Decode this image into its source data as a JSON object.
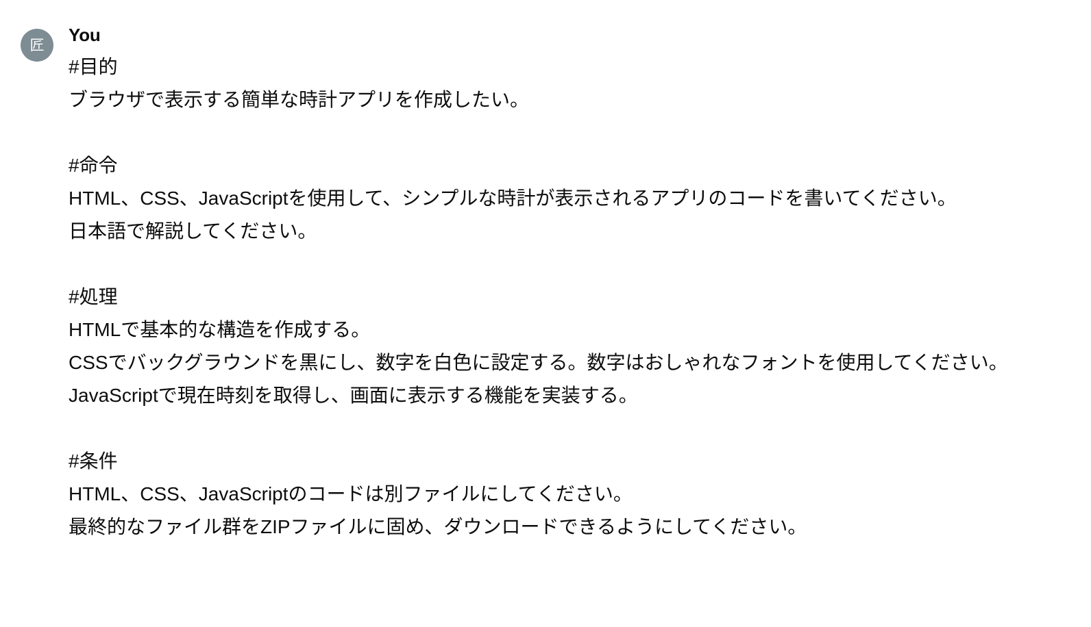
{
  "message": {
    "avatar": {
      "glyph": "匠",
      "icon_name": "user-avatar-kanji",
      "background_color": "#7e8c94",
      "glyph_color": "#ffffff"
    },
    "author": "You",
    "text_color": "#0d0d0d",
    "background_color": "#ffffff",
    "blocks": [
      {
        "heading": "#目的",
        "lines": [
          "ブラウザで表示する簡単な時計アプリを作成したい。"
        ]
      },
      {
        "heading": "#命令",
        "lines": [
          "HTML、CSS、JavaScriptを使用して、シンプルな時計が表示されるアプリのコードを書いてください。",
          "日本語で解説してください。"
        ]
      },
      {
        "heading": "#処理",
        "lines": [
          "HTMLで基本的な構造を作成する。",
          "CSSでバックグラウンドを黒にし、数字を白色に設定する。数字はおしゃれなフォントを使用してください。",
          "JavaScriptで現在時刻を取得し、画面に表示する機能を実装する。"
        ]
      },
      {
        "heading": "#条件",
        "lines": [
          "HTML、CSS、JavaScriptのコードは別ファイルにしてください。",
          "最終的なファイル群をZIPファイルに固め、ダウンロードできるようにしてください。"
        ]
      }
    ]
  }
}
